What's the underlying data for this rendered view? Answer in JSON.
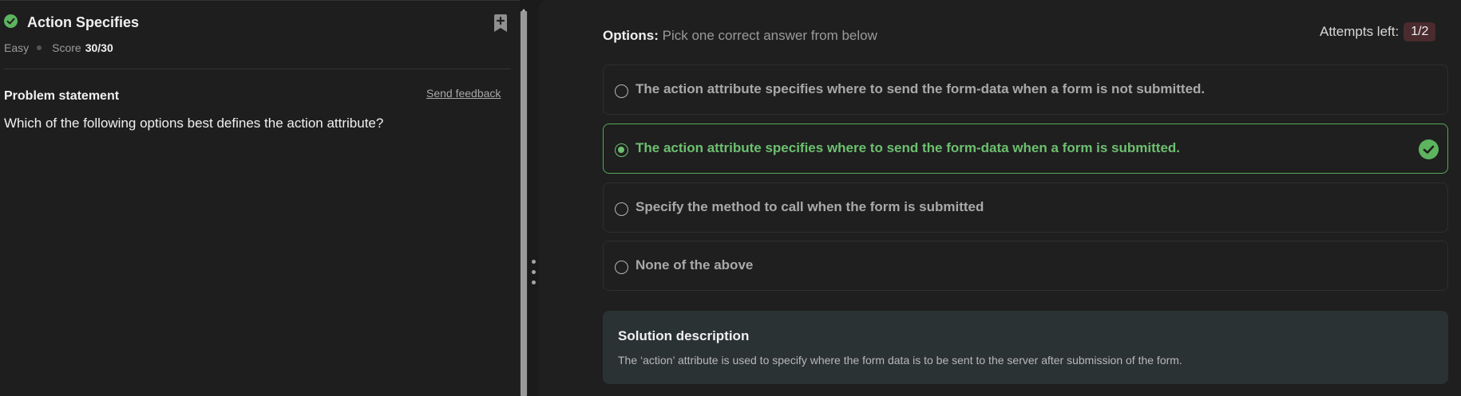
{
  "problem": {
    "title": "Action Specifies",
    "difficulty": "Easy",
    "score_label": "Score",
    "score_value": "30/30",
    "statement_heading": "Problem statement",
    "feedback_link": "Send feedback",
    "question": "Which of the following options best defines the action attribute?"
  },
  "options_panel": {
    "heading_bold": "Options:",
    "heading_text": "Pick one correct answer from below",
    "attempts_label": "Attempts left:",
    "attempts_value": "1/2",
    "options": [
      {
        "text": "The action attribute specifies where to send the form-data when a form is not submitted.",
        "selected": false
      },
      {
        "text": "The action attribute specifies where to send the form-data when a form is submitted.",
        "selected": true,
        "correct": true
      },
      {
        "text": "Specify the method to call when the form is submitted",
        "selected": false
      },
      {
        "text": "None of the above",
        "selected": false
      }
    ]
  },
  "solution": {
    "heading": "Solution description",
    "text": "The ‘action’ attribute is used to specify where the form data is to be sent to the server after submission of the form."
  },
  "icons": {
    "status": "check-circle-icon",
    "bookmark": "bookmark-add-icon",
    "correct": "check-circle-icon"
  },
  "colors": {
    "accent_green": "#5db45e",
    "attempts_badge": "#4a2b2e",
    "solution_bg": "#2b3234"
  }
}
